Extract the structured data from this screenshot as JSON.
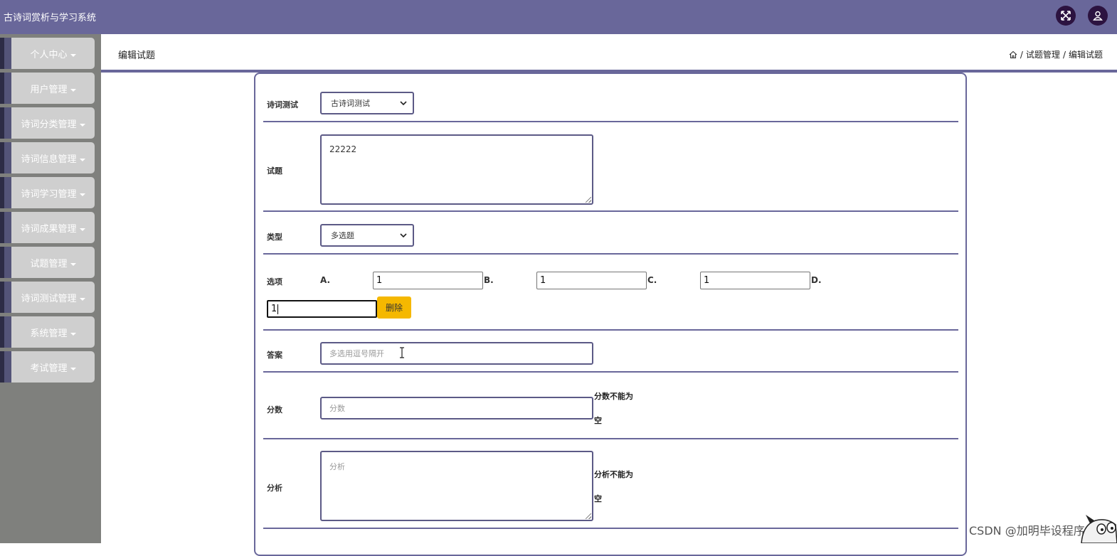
{
  "app": {
    "title": "古诗词赏析与学习系统"
  },
  "topbar": {
    "fullscreen_icon": "expand-icon",
    "user_icon": "user-icon"
  },
  "sidebar": {
    "items": [
      {
        "label": "个人中心"
      },
      {
        "label": "用户管理"
      },
      {
        "label": "诗词分类管理"
      },
      {
        "label": "诗词信息管理"
      },
      {
        "label": "诗词学习管理"
      },
      {
        "label": "诗词成果管理"
      },
      {
        "label": "试题管理"
      },
      {
        "label": "诗词测试管理"
      },
      {
        "label": "系统管理"
      },
      {
        "label": "考试管理"
      }
    ]
  },
  "header": {
    "title": "编辑试题",
    "breadcrumb": {
      "home_icon": "home-icon",
      "sep": "/",
      "parent": "试题管理",
      "current": "编辑试题"
    }
  },
  "form": {
    "test": {
      "label": "诗词测试",
      "value": "古诗词测试"
    },
    "question": {
      "label": "试题",
      "value": "22222"
    },
    "type": {
      "label": "类型",
      "value": "多选题"
    },
    "options": {
      "label": "选项",
      "items": [
        {
          "letter": "A.",
          "value": "1"
        },
        {
          "letter": "B.",
          "value": "1"
        },
        {
          "letter": "C.",
          "value": "1"
        },
        {
          "letter": "D.",
          "value": "1"
        }
      ],
      "delete_label": "删除"
    },
    "answer": {
      "label": "答案",
      "placeholder": "多选用逗号隔开"
    },
    "score": {
      "label": "分数",
      "placeholder": "分数",
      "error_line1": "分数不能为",
      "error_line2": "空"
    },
    "analysis": {
      "label": "分析",
      "placeholder": "分析",
      "error_line1": "分析不能为",
      "error_line2": "空"
    }
  },
  "watermark": "CSDN @加明毕设程序",
  "colors": {
    "topbar": "#69679a",
    "sidebar": "#7f807d",
    "accent": "#69679a",
    "delete_button": "#f5b800"
  }
}
